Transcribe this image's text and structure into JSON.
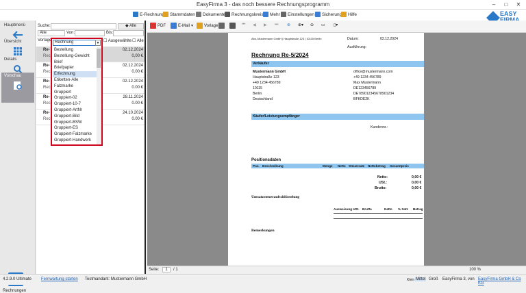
{
  "window": {
    "title": "EasyFirma 3 - das noch bessere Rechnungsprogramm"
  },
  "menu": [
    {
      "label": "E-Rechnung",
      "color": "#2a78c8"
    },
    {
      "label": "Stammdaten",
      "color": "#e0a020"
    },
    {
      "label": "Dokumente",
      "color": "#777777"
    },
    {
      "label": "Rechnungskreise",
      "color": "#555555"
    },
    {
      "label": "Mehr",
      "color": "#3a7bd5"
    },
    {
      "label": "Einstellungen",
      "color": "#666666"
    },
    {
      "label": "Sicherung",
      "color": "#3a7bd5"
    },
    {
      "label": "Hilfe",
      "color": "#e0a020"
    }
  ],
  "brand": {
    "line1": "EASY",
    "line2": "FIRMA",
    "version": "3"
  },
  "sidebar": {
    "items": [
      {
        "label": "Hauptmenü"
      },
      {
        "label": "Übersicht"
      },
      {
        "label": "Details"
      },
      {
        "label": "Vorschau"
      }
    ],
    "bottom_label": "Rechnungen"
  },
  "filters": {
    "search_label": "Suche:",
    "all_button": "Alle",
    "range_value": "Alle",
    "from_label": "Von:",
    "to_label": "Bis:",
    "template_label": "Vorlage:",
    "selected_template": "Rechnung",
    "auswahl_label": "Ausgewählte",
    "auswahl_all": "Alle"
  },
  "list": [
    {
      "no": "Re-",
      "sub": "Rech",
      "date": "02.12.2024",
      "amount": "0,00 €"
    },
    {
      "no": "Re-",
      "sub": "Rech",
      "date": "02.12.2024",
      "amount": "0.00 €"
    },
    {
      "no": "Re-",
      "sub": "Rech",
      "date": "02.12.2024",
      "amount": "0.00 €"
    },
    {
      "no": "Re-",
      "sub": "Rech",
      "date": "28.11.2024",
      "amount": "0.00 €"
    },
    {
      "no": "Re-",
      "sub": "Rech",
      "date": "24.10.2024",
      "amount": "0.00 €"
    }
  ],
  "dropdown": {
    "selected": "Rechnung",
    "options": [
      "Bestellung",
      "Bestellung-Gewicht",
      "Brief",
      "Briefpapier",
      "Erfechnung",
      "Etiketten-Alle",
      "Falzmarke",
      "Gruppiert",
      "Gruppiert-02",
      "Gruppiert-10-7",
      "Gruppiert-ArtNr",
      "Gruppiert-Bild",
      "Gruppiert-BSW",
      "Gruppiert-ES",
      "Gruppiert-Falzmarke",
      "Gruppiert-Handwerk"
    ]
  },
  "toolbar": {
    "pdf": "PDF",
    "email": "E-Mail",
    "template": "Vorlage"
  },
  "invoice": {
    "sender_line": "Abs.:Mustermann GmbH | Hauptstraße 123 | 10115 Berlin",
    "date_label": "Datum:",
    "date_value": "02.12.2024",
    "delivery_label": "Ausführung:",
    "title": "Rechnung Re-5/2024",
    "seller_header": "Verkäufer",
    "seller": [
      "Mustermann GmbH",
      "Hauptstraße 123",
      "+49 1234 456789",
      "10115",
      "Berlin",
      "Deutschland"
    ],
    "seller_right": [
      "office@mustermann.com",
      "+49 1234 456789",
      "Max Mustermann",
      "DE123456789",
      "DE789012345678901234",
      "BFKDE2K"
    ],
    "buyer_header": "Käufer/Leistungsempfänger",
    "customer_label": "Kundennr.:",
    "positions_title": "Positionsdaten",
    "pos_cols": [
      "Pos.",
      "Beschreibung",
      "Menge",
      "Netto",
      "Steuersatz",
      "Nettobetrag",
      "Gesamtpreis"
    ],
    "net_label": "Netto:",
    "net_value": "0,00 €",
    "vat_label": "USt.:",
    "vat_value": "0,00 €",
    "gross_label": "Brutto:",
    "gross_value": "0,00 €",
    "vat_summary_title": "Umsatzsteueraufschlüsselung",
    "vat_cols": [
      "Ausweisung USt.",
      "Brutto",
      "Netto",
      "% Satz",
      "Betrag"
    ],
    "remarks_title": "Bemerkungen"
  },
  "pager": {
    "label": "Seite:",
    "current": "1",
    "total": "/ 1",
    "zoom": "100 %"
  },
  "status": {
    "version": "4.2.9.0 Ultimate",
    "link": "Fernwartung starten",
    "tenant": "Testmandant: Mustermann GmbH",
    "sizes": [
      "Klein",
      "Mittel",
      "Groß"
    ],
    "credit_prefix": "EasyFirma 3, von",
    "credit_link": "EasyFirma GmbH & Co KG"
  }
}
